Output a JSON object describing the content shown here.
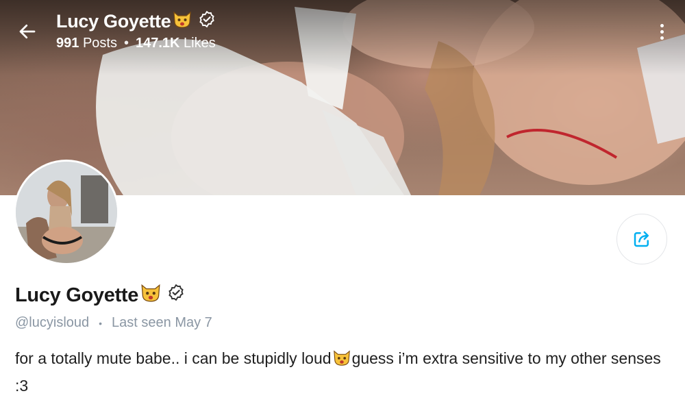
{
  "header": {
    "name": "Lucy Goyette",
    "posts_count": "991",
    "posts_label": "Posts",
    "likes_count": "147.1K",
    "likes_label": "Likes"
  },
  "profile": {
    "display_name": "Lucy Goyette",
    "username": "@lucyisloud",
    "last_seen": "Last seen May 7",
    "bio_part1": "for a totally mute babe.. i can be stupidly loud",
    "bio_part2": "guess i’m extra sensitive to my other senses :3",
    "emoji": "cat-face-emoji",
    "verified_icon": "verified-badge-icon"
  },
  "icons": {
    "back": "back-arrow-icon",
    "more": "more-vertical-icon",
    "share": "share-icon"
  },
  "colors": {
    "accent": "#00aff0",
    "muted_text": "#8a96a3",
    "emoji_yellow": "#f7c23a"
  }
}
